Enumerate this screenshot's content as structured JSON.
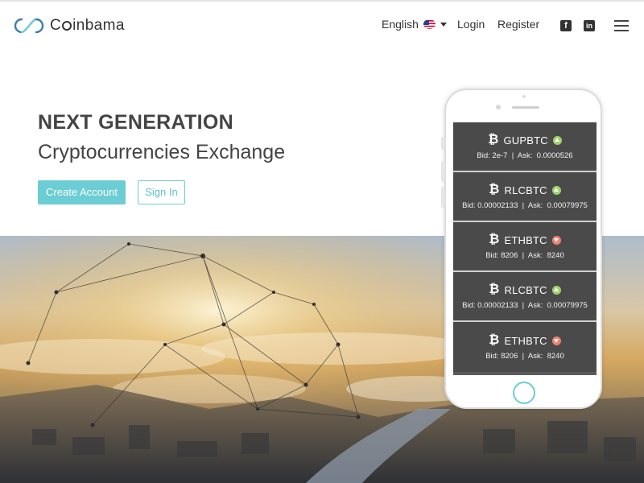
{
  "brand": {
    "name_prefix": "C",
    "name_suffix": "inbama",
    "accent": "#6ccdd4"
  },
  "nav": {
    "language": "English",
    "login": "Login",
    "register": "Register",
    "facebook_glyph": "f",
    "linkedin_glyph": "in"
  },
  "hero": {
    "title": "NEXT GENERATION",
    "subtitle": "Cryptocurrencies Exchange",
    "create_account": "Create Account",
    "sign_in": "Sign In"
  },
  "tickers": [
    {
      "pair": "GUPBTC",
      "trend": "up",
      "quote": "Bid: 2e-7  |  Ask:  0.0000526"
    },
    {
      "pair": "RLCBTC",
      "trend": "up",
      "quote": "Bid: 0.00002133  |  Ask:  0.00079975"
    },
    {
      "pair": "ETHBTC",
      "trend": "down",
      "quote": "Bid: 8206  |  Ask:  8240"
    },
    {
      "pair": "RLCBTC",
      "trend": "up",
      "quote": "Bid: 0.00002133  |  Ask:  0.00079975"
    },
    {
      "pair": "ETHBTC",
      "trend": "down",
      "quote": "Bid: 8206  |  Ask:  8240"
    }
  ],
  "icons": {
    "logo": "infinity-logo-icon",
    "bitcoin": "bitcoin-icon",
    "menu": "hamburger-menu-icon"
  }
}
